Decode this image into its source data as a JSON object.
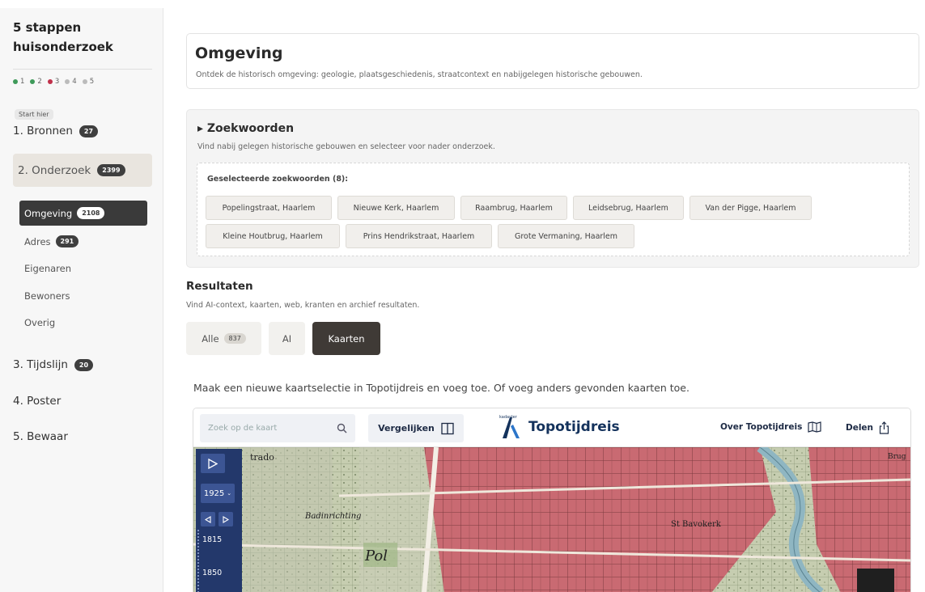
{
  "sidebar": {
    "app_title": "5 stappen huisonderzoek",
    "steps": [
      {
        "num": "1",
        "color": "#3f9a5a"
      },
      {
        "num": "2",
        "color": "#3f9a5a"
      },
      {
        "num": "3",
        "color": "#c0304a"
      },
      {
        "num": "4",
        "color": "#bbbbbb"
      },
      {
        "num": "5",
        "color": "#bbbbbb"
      }
    ],
    "start_label": "Start hier",
    "nav": {
      "bronnen": {
        "label": "1. Bronnen",
        "count": "27"
      },
      "onderzoek": {
        "label": "2. Onderzoek",
        "count": "2399"
      },
      "tijdslijn": {
        "label": "3. Tijdslijn",
        "count": "20"
      },
      "poster": {
        "label": "4. Poster"
      },
      "bewaar": {
        "label": "5. Bewaar"
      }
    },
    "sub": {
      "omgeving": {
        "label": "Omgeving",
        "count": "2108"
      },
      "adres": {
        "label": "Adres",
        "count": "291"
      },
      "eigenaren": {
        "label": "Eigenaren"
      },
      "bewoners": {
        "label": "Bewoners"
      },
      "overig": {
        "label": "Overig"
      }
    }
  },
  "header": {
    "title": "Omgeving",
    "subtitle": "Ontdek de historisch omgeving: geologie, plaatsgeschiedenis, straatcontext en nabijgelegen historische gebouwen."
  },
  "keywords": {
    "title": "▸ Zoekwoorden",
    "subtitle": "Vind nabij gelegen historische gebouwen en selecteer voor nader onderzoek.",
    "selected_label": "Geselecteerde zoekwoorden (8):",
    "tags": [
      "Popelingstraat, Haarlem",
      "Nieuwe Kerk, Haarlem",
      "Raambrug, Haarlem",
      "Leidsebrug, Haarlem",
      "Van der Pigge, Haarlem",
      "Kleine Houtbrug, Haarlem",
      "Prins Hendrikstraat, Haarlem",
      "Grote Vermaning, Haarlem"
    ]
  },
  "results": {
    "title": "Resultaten",
    "subtitle": "Vind AI-context, kaarten, web, kranten en archief resultaten.",
    "tabs": {
      "alle": {
        "label": "Alle",
        "count": "837"
      },
      "ai": {
        "label": "AI"
      },
      "kaarten": {
        "label": "Kaarten"
      }
    }
  },
  "map": {
    "intro": "Maak een nieuwe kaartselectie in Topotijdreis en voeg toe. Of voeg anders gevonden kaarten toe.",
    "search_placeholder": "Zoek op de kaart",
    "compare_label": "Vergelijken",
    "brand_small": "kadaster",
    "brand": "Topotijdreis",
    "about_label": "Over Topotijdreis",
    "share_label": "Delen",
    "year_select": "1925",
    "timeline_years": [
      "1815",
      "1850"
    ],
    "place_labels": [
      "trado",
      "Badinrichting",
      "Pol",
      "St Bavokerk",
      "Brug"
    ],
    "accent_color": "#23386b"
  }
}
